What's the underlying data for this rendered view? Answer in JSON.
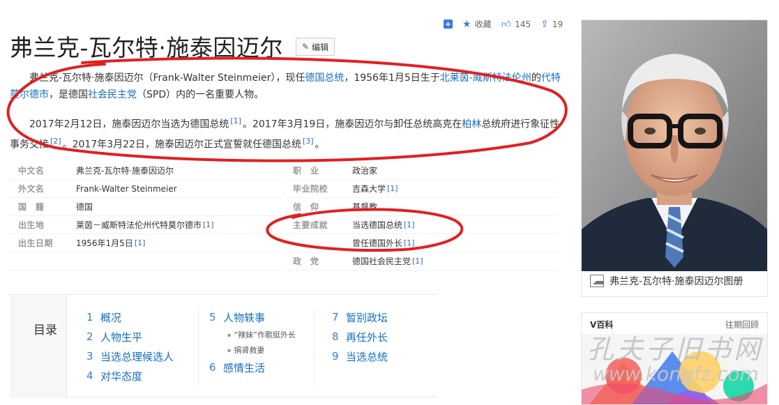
{
  "actions": {
    "add_label": "+",
    "favorite_label": "收藏",
    "like_count": "145",
    "share_count": "19"
  },
  "title": "弗兰克-瓦尔特·施泰因迈尔",
  "edit_label": "编辑",
  "intro": {
    "p1_a": "弗兰克-瓦尔特·施泰因迈尔（Frank-Walter Steinmeier），现任",
    "p1_link1": "德国总统",
    "p1_b": "，1956年1月5日生于",
    "p1_link2": "北莱茵-威斯特法伦州",
    "p1_c": "的",
    "p1_link3": "代特莫尔德市",
    "p1_d": "，是德国",
    "p1_link4": "社会民主党",
    "p1_e": "（SPD）内的一名重要人物。",
    "p2_a": "2017年2月12日，施泰因迈尔当选为德国总统",
    "p2_ref1": "[1]",
    "p2_b": "。2017年3月19日，施泰因迈尔与卸任总统高克在",
    "p2_link1": "柏林",
    "p2_c": "总统府进行象征性事务交接",
    "p2_ref2": "[2]",
    "p2_d": "。2017年3月22日，施泰因迈尔正式宣誓就任德国总统",
    "p2_ref3": "[3]",
    "p2_e": "。"
  },
  "info_left": [
    {
      "key": "中文名",
      "value": "弗兰克-瓦尔特·施泰因迈尔",
      "ref": ""
    },
    {
      "key": "外文名",
      "value": "Frank-Walter Steinmeier",
      "ref": ""
    },
    {
      "key": "国　籍",
      "value": "德国",
      "ref": ""
    },
    {
      "key": "出生地",
      "value": "莱茵－威斯特法伦州代特莫尔德市",
      "ref": "[1]"
    },
    {
      "key": "出生日期",
      "value": "1956年1月5日",
      "ref": "[1]"
    }
  ],
  "info_right": [
    {
      "key": "职　业",
      "value": "政治家",
      "ref": ""
    },
    {
      "key": "毕业院校",
      "value": "吉森大学",
      "ref": "[1]"
    },
    {
      "key": "信　仰",
      "value": "基督教",
      "ref": ""
    },
    {
      "key": "主要成就",
      "value": "当选德国总统",
      "ref": "[1]"
    },
    {
      "key": "",
      "value": "曾任德国外长",
      "ref": "[1]"
    },
    {
      "key": "政　党",
      "value": "德国社会民主党",
      "ref": "[1]"
    }
  ],
  "toc": {
    "title": "目录",
    "col1": [
      {
        "num": "1",
        "label": "概况"
      },
      {
        "num": "2",
        "label": "人物生平"
      },
      {
        "num": "3",
        "label": "当选总理候选人"
      },
      {
        "num": "4",
        "label": "对华态度"
      }
    ],
    "col2_main1": {
      "num": "5",
      "label": "人物轶事"
    },
    "col2_subs": [
      "“辣妹”作歌挺外长",
      "捐肾救妻"
    ],
    "col2_main2": {
      "num": "6",
      "label": "感情生活"
    },
    "col3": [
      {
        "num": "7",
        "label": "暂别政坛"
      },
      {
        "num": "8",
        "label": "再任外长"
      },
      {
        "num": "9",
        "label": "当选总统"
      }
    ]
  },
  "photo_caption": "弗兰克-瓦尔特·施泰因迈尔图册",
  "vcard": {
    "brand": "V百科",
    "more": "往期回顾"
  },
  "watermark": {
    "cn": "孔夫子旧书网",
    "url": "www.kongfz.com"
  },
  "colors": {
    "link": "#136ec2",
    "accent": "#3a7bd5",
    "annotation": "#e02020"
  }
}
